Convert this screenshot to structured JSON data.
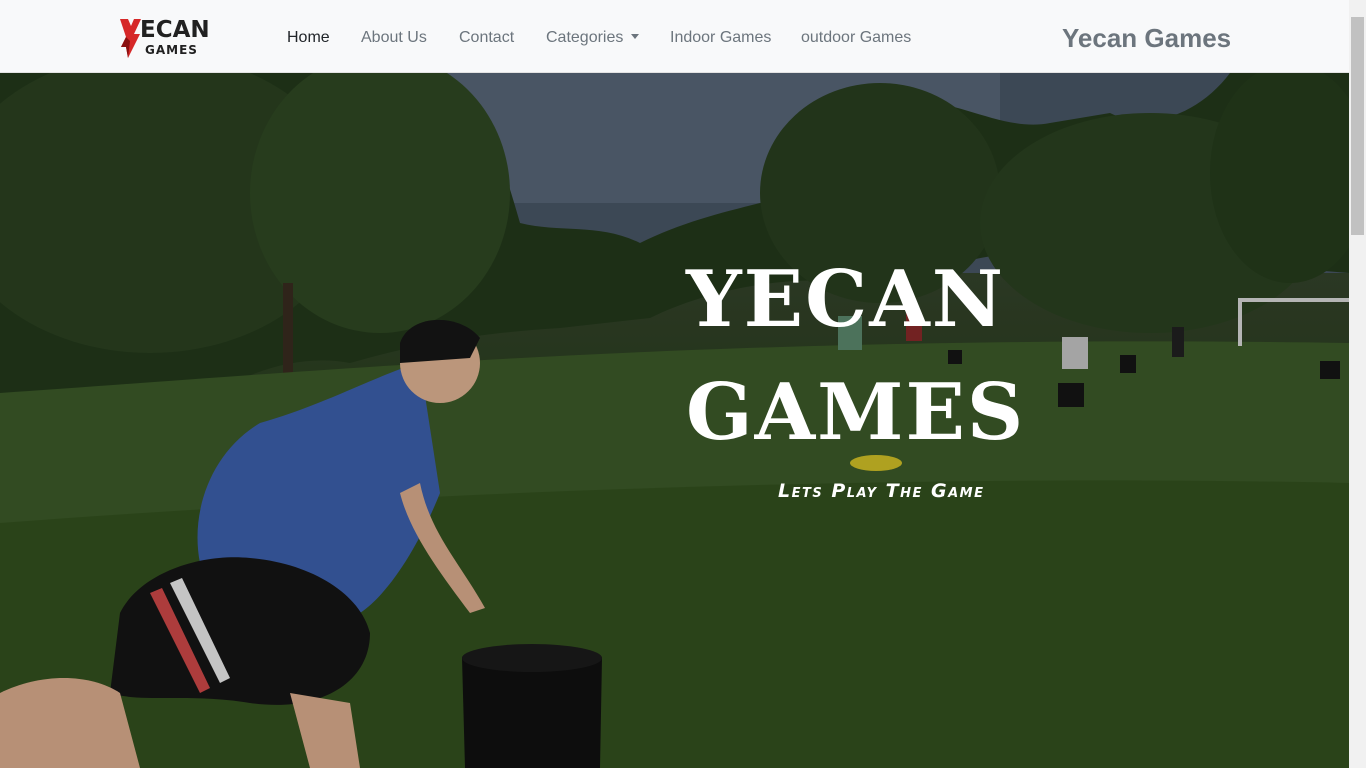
{
  "logo": {
    "top": "ECAN",
    "bottom": "GAMES"
  },
  "nav": {
    "items": [
      {
        "label": "Home"
      },
      {
        "label": "About Us"
      },
      {
        "label": "Contact"
      },
      {
        "label": "Categories"
      },
      {
        "label": "Indoor Games"
      },
      {
        "label": "outdoor Games"
      }
    ],
    "brand": "Yecan Games"
  },
  "hero": {
    "title_line1": "YECAN",
    "title_line2": "GAMES",
    "tagline": "Lets Play The Game"
  },
  "colors": {
    "navbar_bg": "#f8f9fa",
    "nav_text": "#6c757d",
    "nav_active": "#212529",
    "logo_red": "#d62828",
    "hero_text": "#ffffff"
  }
}
